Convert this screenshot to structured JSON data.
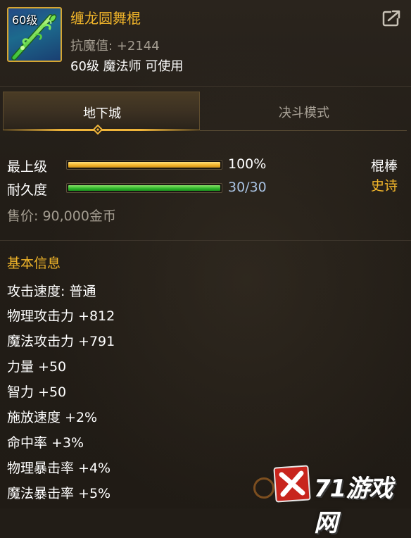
{
  "item": {
    "level_badge": "60级",
    "name": "缠龙圆舞棍",
    "magic_resist": "抗魔值: +2144",
    "requirement": "60级 魔法师 可使用",
    "icon": "green-dragon-staff-icon",
    "share_icon": "share-export-icon"
  },
  "tabs": [
    {
      "label": "地下城",
      "active": true
    },
    {
      "label": "决斗模式",
      "active": false
    }
  ],
  "bars": [
    {
      "label": "最上级",
      "value_text": "100%",
      "fill_fraction": 1.0,
      "color": "#f2b227",
      "value_color": "#ffffff"
    },
    {
      "label": "耐久度",
      "value_text": "30/30",
      "fill_fraction": 1.0,
      "color": "#2eb52a",
      "value_color": "#a9c3e3"
    }
  ],
  "weapon_type": "棍棒",
  "rarity": "史诗",
  "rarity_color": "#f1b52a",
  "price": "售价: 90,000金币",
  "basic_info": {
    "title": "基本信息",
    "attributes": [
      "攻击速度: 普通",
      "物理攻击力 +812",
      "魔法攻击力 +791",
      "力量 +50",
      "智力 +50",
      "施放速度 +2%",
      "命中率 +3%",
      "物理暴击率 +4%",
      "魔法暴击率 +5%"
    ]
  },
  "watermark": {
    "text": "71游戏网",
    "logo_icon": "x-logo-icon"
  }
}
